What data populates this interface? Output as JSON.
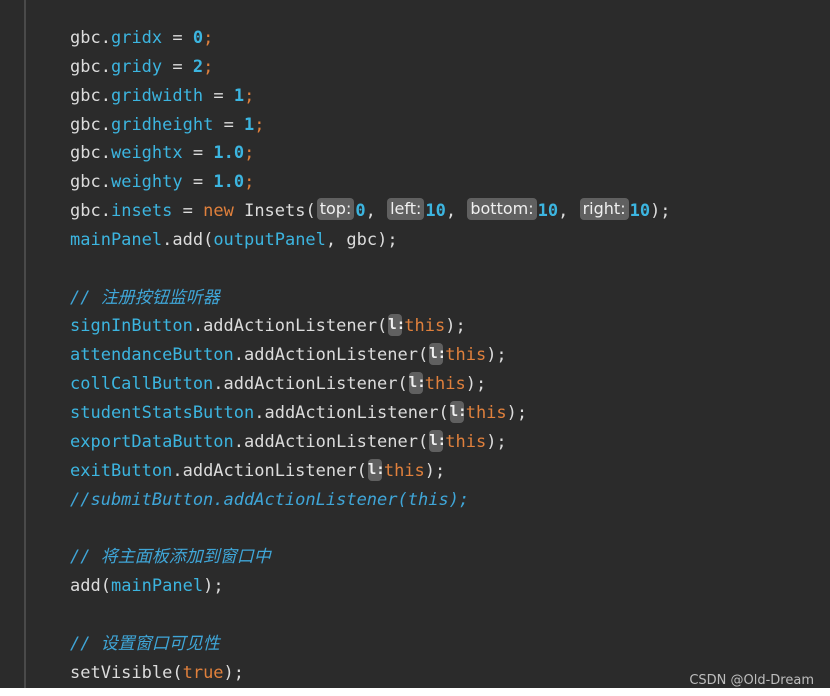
{
  "code_lines": [
    {
      "obj": "gbc",
      "field": "gridx",
      "value": "0"
    },
    {
      "obj": "gbc",
      "field": "gridy",
      "value": "2"
    },
    {
      "obj": "gbc",
      "field": "gridwidth",
      "value": "1"
    },
    {
      "obj": "gbc",
      "field": "gridheight",
      "value": "1"
    },
    {
      "obj": "gbc",
      "field": "weightx",
      "value": "1.0"
    },
    {
      "obj": "gbc",
      "field": "weighty",
      "value": "1.0"
    }
  ],
  "insets_line": {
    "obj": "gbc",
    "field": "insets",
    "kw_new": "new",
    "cls": "Insets(",
    "hints": [
      "top:",
      "left:",
      "bottom:",
      "right:"
    ],
    "values": [
      "0",
      "10",
      "10",
      "10"
    ]
  },
  "add_line": {
    "obj": "mainPanel",
    "call": ".add(",
    "arg1": "outputPanel",
    "rest": ", gbc);"
  },
  "comment_register": "// 注册按钮监听器",
  "listeners": [
    {
      "button": "signInButton"
    },
    {
      "button": "attendanceButton"
    },
    {
      "button": "collCallButton"
    },
    {
      "button": "studentStatsButton"
    },
    {
      "button": "exportDataButton"
    },
    {
      "button": "exitButton"
    }
  ],
  "listener_method": ".addActionListener(",
  "listener_hint": "l:",
  "this_kw": "this",
  "commented_listener": "//submitButton.addActionListener(this);",
  "comment_add_panel": "// 将主面板添加到窗口中",
  "add_main_panel": {
    "call": "add(",
    "arg": "mainPanel",
    "close": ");"
  },
  "comment_visible": "// 设置窗口可见性",
  "set_visible": {
    "call": "setVisible(",
    "arg": "true",
    "close": ");"
  },
  "watermark": "CSDN @Old-Dream"
}
